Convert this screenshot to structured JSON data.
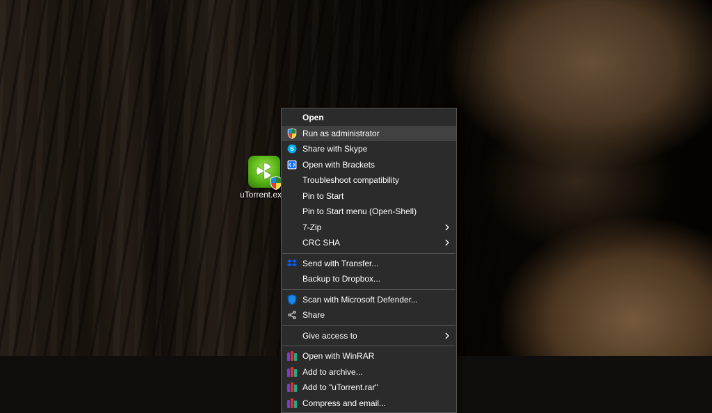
{
  "desktop": {
    "icon_label": "uTorrent.ex..."
  },
  "menu": {
    "open": "Open",
    "run_admin": "Run as administrator",
    "share_skype": "Share with Skype",
    "open_brackets": "Open with Brackets",
    "troubleshoot": "Troubleshoot compatibility",
    "pin_start": "Pin to Start",
    "pin_openshell": "Pin to Start menu (Open-Shell)",
    "seven_zip": "7-Zip",
    "crc_sha": "CRC SHA",
    "send_transfer": "Send with Transfer...",
    "backup_dropbox": "Backup to Dropbox...",
    "scan_defender": "Scan with Microsoft Defender...",
    "share": "Share",
    "give_access": "Give access to",
    "open_winrar": "Open with WinRAR",
    "add_archive": "Add to archive...",
    "add_named": "Add to \"uTorrent.rar\"",
    "compress_email": "Compress and email..."
  }
}
